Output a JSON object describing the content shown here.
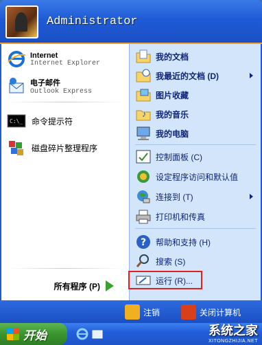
{
  "header": {
    "username": "Administrator"
  },
  "pinned": [
    {
      "title": "Internet",
      "subtitle": "Internet Explorer"
    },
    {
      "title": "电子邮件",
      "subtitle": "Outlook Express"
    }
  ],
  "recent_programs": [
    {
      "label": "命令提示符"
    },
    {
      "label": "磁盘碎片整理程序"
    }
  ],
  "all_programs_label": "所有程序 (P)",
  "right_items": [
    {
      "label": "我的文档"
    },
    {
      "label": "我最近的文档 (D)"
    },
    {
      "label": "图片收藏"
    },
    {
      "label": "我的音乐"
    },
    {
      "label": "我的电脑"
    },
    {
      "label": "控制面板 (C)"
    },
    {
      "label": "设定程序访问和默认值"
    },
    {
      "label": "连接到 (T)"
    },
    {
      "label": "打印机和传真"
    },
    {
      "label": "帮助和支持 (H)"
    },
    {
      "label": "搜索 (S)"
    },
    {
      "label": "运行 (R)..."
    }
  ],
  "footer": {
    "logoff": "注销",
    "shutdown": "关闭计算机"
  },
  "taskbar": {
    "start_label": "开始"
  },
  "watermark": {
    "brand": "系统之家",
    "url": "XITONGZHIJIA.NET"
  },
  "colors": {
    "highlight_box": "#e02020",
    "menu_blue": "#1f5ad1",
    "right_pane": "#d3e5fa",
    "start_green": "#3a952e"
  }
}
